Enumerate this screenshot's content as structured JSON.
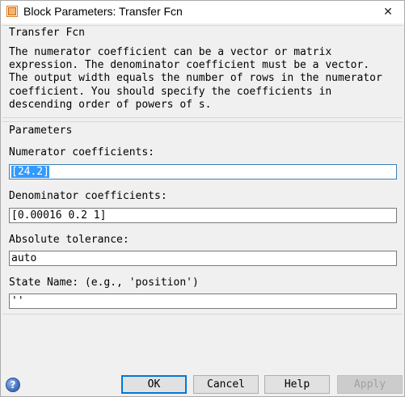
{
  "window": {
    "title": "Block Parameters: Transfer Fcn",
    "close_glyph": "✕",
    "app_icon": "simulink-block-icon"
  },
  "description": {
    "group_label": "Transfer Fcn",
    "lines": [
      "The numerator coefficient can be a vector or matrix",
      "expression. The denominator coefficient must be a vector.",
      "The output width equals the number of rows in the numerator",
      "coefficient. You should specify the coefficients in",
      "descending order of powers of s."
    ]
  },
  "parameters": {
    "group_label": "Parameters",
    "numerator": {
      "label": "Numerator coefficients:",
      "value": "[24.2]",
      "focused": true,
      "selected": true
    },
    "denominator": {
      "label": "Denominator coefficients:",
      "value": "[0.00016 0.2 1]"
    },
    "abstol": {
      "label": "Absolute tolerance:",
      "value": "auto"
    },
    "state_name": {
      "label": "State Name: (e.g., 'position')",
      "value": "''"
    }
  },
  "buttons": {
    "ok": "OK",
    "cancel": "Cancel",
    "help": "Help",
    "apply": "Apply",
    "apply_disabled": true
  },
  "colors": {
    "dialog_bg": "#f0f0f0",
    "focus_border": "#3c7fb1",
    "selection": "#3399ff",
    "default_button_border": "#0078d7"
  }
}
